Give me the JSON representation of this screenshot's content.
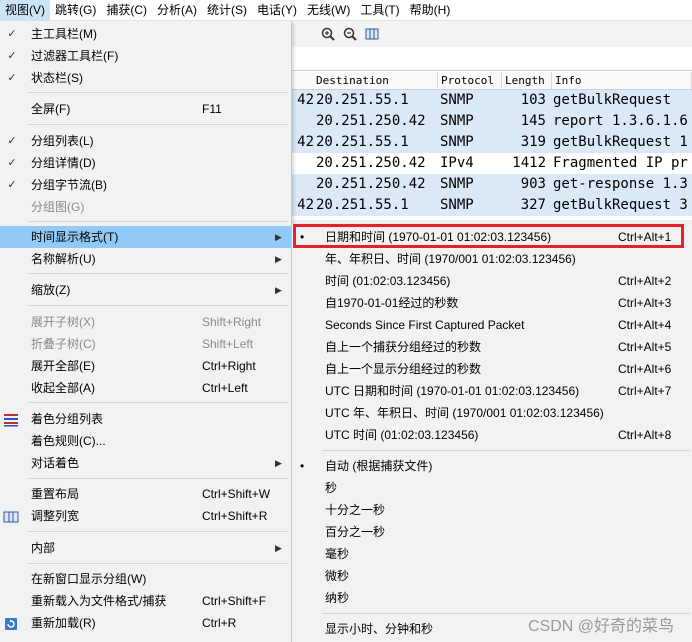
{
  "menubar": {
    "items": [
      {
        "label": "视图(V)",
        "active": true
      },
      {
        "label": "跳转(G)"
      },
      {
        "label": "捕获(C)"
      },
      {
        "label": "分析(A)"
      },
      {
        "label": "统计(S)"
      },
      {
        "label": "电话(Y)"
      },
      {
        "label": "无线(W)"
      },
      {
        "label": "工具(T)"
      },
      {
        "label": "帮助(H)"
      }
    ]
  },
  "toolbar": {
    "icons": [
      "zoom-in-icon",
      "zoom-out-icon",
      "resize-columns-icon"
    ]
  },
  "packet_list": {
    "columns": {
      "destination": "Destination",
      "protocol": "Protocol",
      "length": "Length",
      "info": "Info"
    },
    "rows": [
      {
        "pre": "42",
        "destination": "20.251.55.1",
        "protocol": "SNMP",
        "length": "103",
        "info": "getBulkRequest"
      },
      {
        "pre": "",
        "destination": "20.251.250.42",
        "protocol": "SNMP",
        "length": "145",
        "info": "report 1.3.6.1.6"
      },
      {
        "pre": "42",
        "destination": "20.251.55.1",
        "protocol": "SNMP",
        "length": "319",
        "info": "getBulkRequest 1"
      },
      {
        "pre": "",
        "destination": "20.251.250.42",
        "protocol": "IPv4",
        "length": "1412",
        "info": "Fragmented IP pr"
      },
      {
        "pre": "",
        "destination": "20.251.250.42",
        "protocol": "SNMP",
        "length": "903",
        "info": "get-response 1.3"
      },
      {
        "pre": "42",
        "destination": "20.251.55.1",
        "protocol": "SNMP",
        "length": "327",
        "info": "getBulkRequest 3"
      }
    ]
  },
  "view_menu": {
    "main_toolbar": {
      "label": "主工具栏(M)"
    },
    "filter_toolbar": {
      "label": "过滤器工具栏(F)"
    },
    "status_bar": {
      "label": "状态栏(S)"
    },
    "fullscreen": {
      "label": "全屏(F)",
      "shortcut": "F11"
    },
    "packet_list": {
      "label": "分组列表(L)"
    },
    "packet_details": {
      "label": "分组详情(D)"
    },
    "packet_bytes": {
      "label": "分组字节流(B)"
    },
    "packet_diagram": {
      "label": "分组图(G)"
    },
    "time_display_format": {
      "label": "时间显示格式(T)"
    },
    "name_resolution": {
      "label": "名称解析(U)"
    },
    "zoom": {
      "label": "缩放(Z)"
    },
    "expand_subtrees": {
      "label": "展开子树(X)",
      "shortcut": "Shift+Right"
    },
    "collapse_subtrees": {
      "label": "折叠子树(C)",
      "shortcut": "Shift+Left"
    },
    "expand_all": {
      "label": "展开全部(E)",
      "shortcut": "Ctrl+Right"
    },
    "collapse_all": {
      "label": "收起全部(A)",
      "shortcut": "Ctrl+Left"
    },
    "colorize_packet_list": {
      "label": "着色分组列表"
    },
    "coloring_rules": {
      "label": "着色规则(C)..."
    },
    "colorize_conversation": {
      "label": "对话着色"
    },
    "reset_layout": {
      "label": "重置布局",
      "shortcut": "Ctrl+Shift+W"
    },
    "resize_columns": {
      "label": "调整列宽",
      "shortcut": "Ctrl+Shift+R"
    },
    "internals": {
      "label": "内部"
    },
    "show_packet_new_window": {
      "label": "在新窗口显示分组(W)"
    },
    "reload_as_format": {
      "label": "重新载入为文件格式/捕获",
      "shortcut": "Ctrl+Shift+F"
    },
    "reload": {
      "label": "重新加载(R)",
      "shortcut": "Ctrl+R"
    }
  },
  "time_submenu": {
    "date_time": {
      "label": "日期和时间 (1970-01-01 01:02:03.123456)",
      "shortcut": "Ctrl+Alt+1",
      "selected": true
    },
    "year_doy_time": {
      "label": "年、年积日、时间 (1970/001 01:02:03.123456)"
    },
    "time_of_day": {
      "label": "时间 (01:02:03.123456)",
      "shortcut": "Ctrl+Alt+2"
    },
    "since_epoch": {
      "label": "自1970-01-01经过的秒数",
      "shortcut": "Ctrl+Alt+3"
    },
    "since_first": {
      "label": "Seconds Since First Captured Packet",
      "shortcut": "Ctrl+Alt+4"
    },
    "since_prev_captured": {
      "label": "自上一个捕获分组经过的秒数",
      "shortcut": "Ctrl+Alt+5"
    },
    "since_prev_displayed": {
      "label": "自上一个显示分组经过的秒数",
      "shortcut": "Ctrl+Alt+6"
    },
    "utc_date_time": {
      "label": "UTC 日期和时间 (1970-01-01 01:02:03.123456)",
      "shortcut": "Ctrl+Alt+7"
    },
    "utc_year_doy": {
      "label": "UTC 年、年积日、时间 (1970/001 01:02:03.123456)"
    },
    "utc_time": {
      "label": "UTC 时间 (01:02:03.123456)",
      "shortcut": "Ctrl+Alt+8"
    },
    "auto": {
      "label": "自动 (根据捕获文件)",
      "selected": true
    },
    "seconds": {
      "label": "秒"
    },
    "deciseconds": {
      "label": "十分之一秒"
    },
    "centiseconds": {
      "label": "百分之一秒"
    },
    "milliseconds": {
      "label": "毫秒"
    },
    "microseconds": {
      "label": "微秒"
    },
    "nanoseconds": {
      "label": "纳秒"
    },
    "hms": {
      "label": "显示小时、分钟和秒"
    }
  },
  "glyphs": {
    "check": "✓",
    "bullet": "•",
    "arrow": "▶"
  },
  "watermark": "CSDN @好奇的菜鸟"
}
